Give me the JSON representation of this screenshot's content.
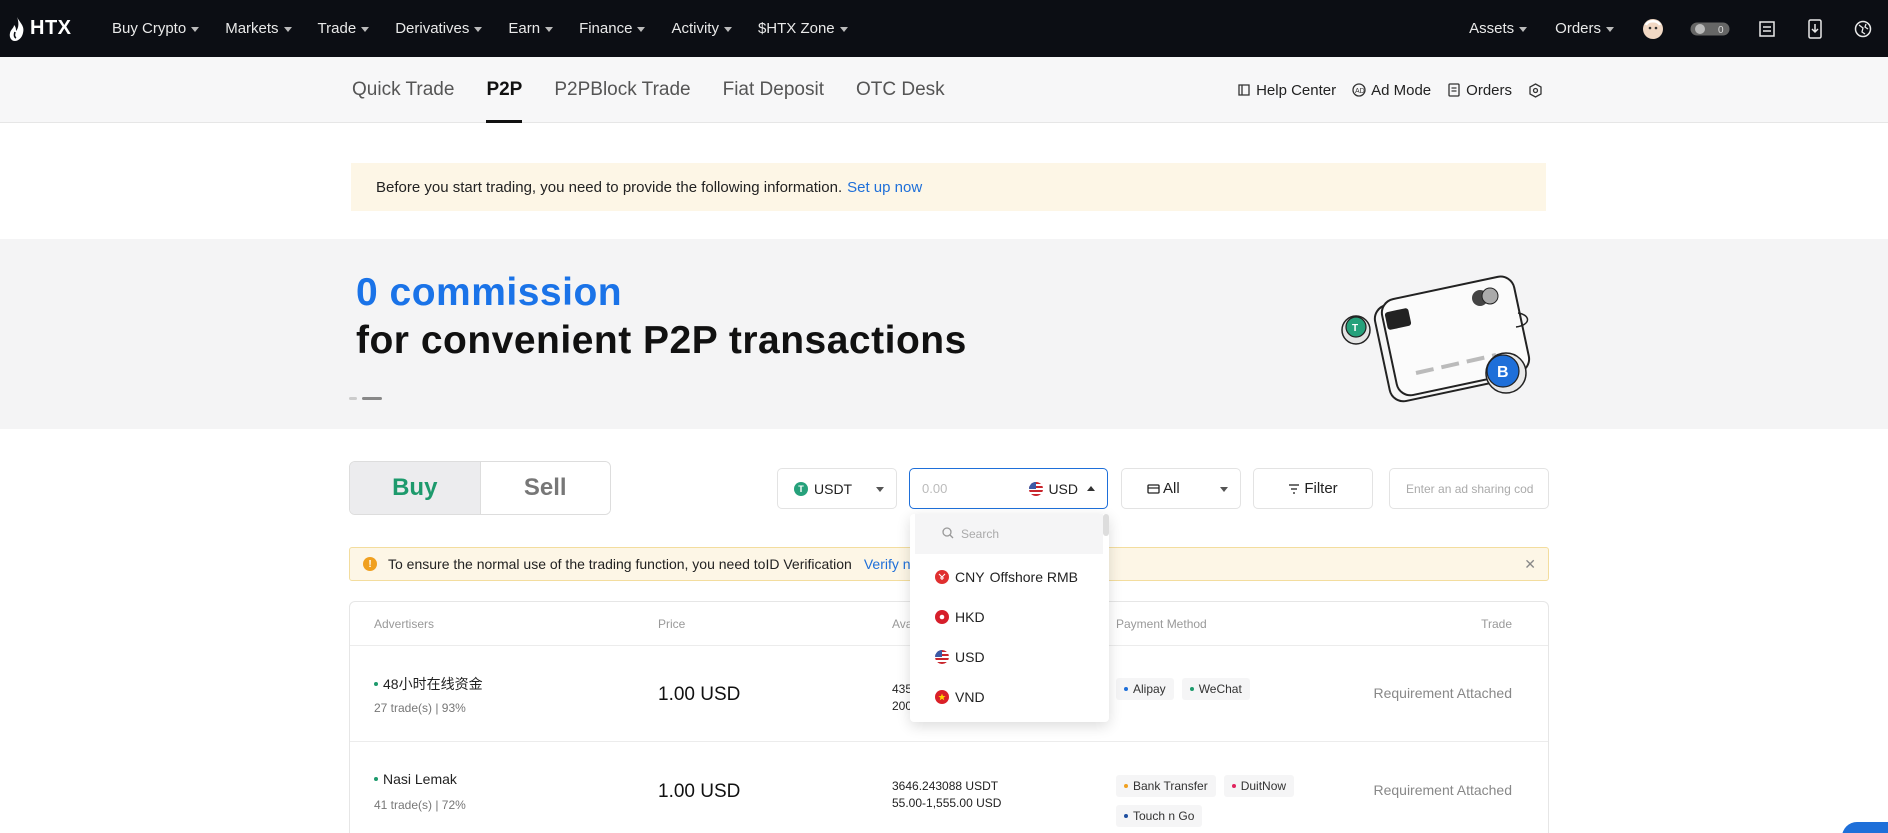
{
  "topnav": {
    "logo": "HTX",
    "items": [
      "Buy Crypto",
      "Markets",
      "Trade",
      "Derivatives",
      "Earn",
      "Finance",
      "Activity",
      "$HTX Zone"
    ],
    "right_items": [
      "Assets",
      "Orders"
    ]
  },
  "subnav": {
    "tabs": [
      "Quick Trade",
      "P2P",
      "P2PBlock Trade",
      "Fiat Deposit",
      "OTC Desk"
    ],
    "active_tab": "P2P",
    "links": [
      "Help Center",
      "Ad Mode",
      "Orders"
    ]
  },
  "notice": {
    "text": "Before you start trading, you need to provide the following information.",
    "link": "Set up now"
  },
  "banner": {
    "headline": "0 commission",
    "subheadline": "for convenient P2P transactions"
  },
  "trade": {
    "buy_label": "Buy",
    "sell_label": "Sell",
    "coin": "USDT",
    "amount_placeholder": "0.00",
    "currency": "USD",
    "payment": "All",
    "filter_label": "Filter",
    "share_placeholder": "Enter an ad sharing cod"
  },
  "warning": {
    "text": "To ensure the normal use of the trading function, you need toID Verification",
    "link": "Verify n"
  },
  "table": {
    "headers": [
      "Advertisers",
      "Price",
      "Ava",
      "Payment Method",
      "Trade"
    ],
    "rows": [
      {
        "advertiser": "48小时在线资金",
        "stats": "27 trade(s) | 93%",
        "price": "1.00 USD",
        "available": "435",
        "limit": "200",
        "payments": [
          {
            "name": "Alipay",
            "color": "#1e6fd9"
          },
          {
            "name": "WeChat",
            "color": "#1d9a6c"
          }
        ],
        "trade": "Requirement Attached"
      },
      {
        "advertiser": "Nasi Lemak",
        "stats": "41 trade(s) | 72%",
        "price": "1.00 USD",
        "available": "3646.243088 USDT",
        "limit": "55.00-1,555.00 USD",
        "payments": [
          {
            "name": "Bank Transfer",
            "color": "#f0a020"
          },
          {
            "name": "DuitNow",
            "color": "#e0245e"
          },
          {
            "name": "Touch n Go",
            "color": "#1e4fa0"
          }
        ],
        "trade": "Requirement Attached"
      }
    ]
  },
  "currency_dropdown": {
    "search_placeholder": "Search",
    "options": [
      {
        "code": "CNY",
        "name": "Offshore RMB",
        "color": "#e03030"
      },
      {
        "code": "HKD",
        "name": "",
        "color": "#d61f2b"
      },
      {
        "code": "USD",
        "name": "",
        "color": "#3c5aa6"
      },
      {
        "code": "VND",
        "name": "",
        "color": "#da2028"
      }
    ]
  },
  "colors": {
    "accent": "#1e6fd9",
    "buy_green": "#1d9a6c",
    "topnav_bg": "#0c0e14"
  }
}
